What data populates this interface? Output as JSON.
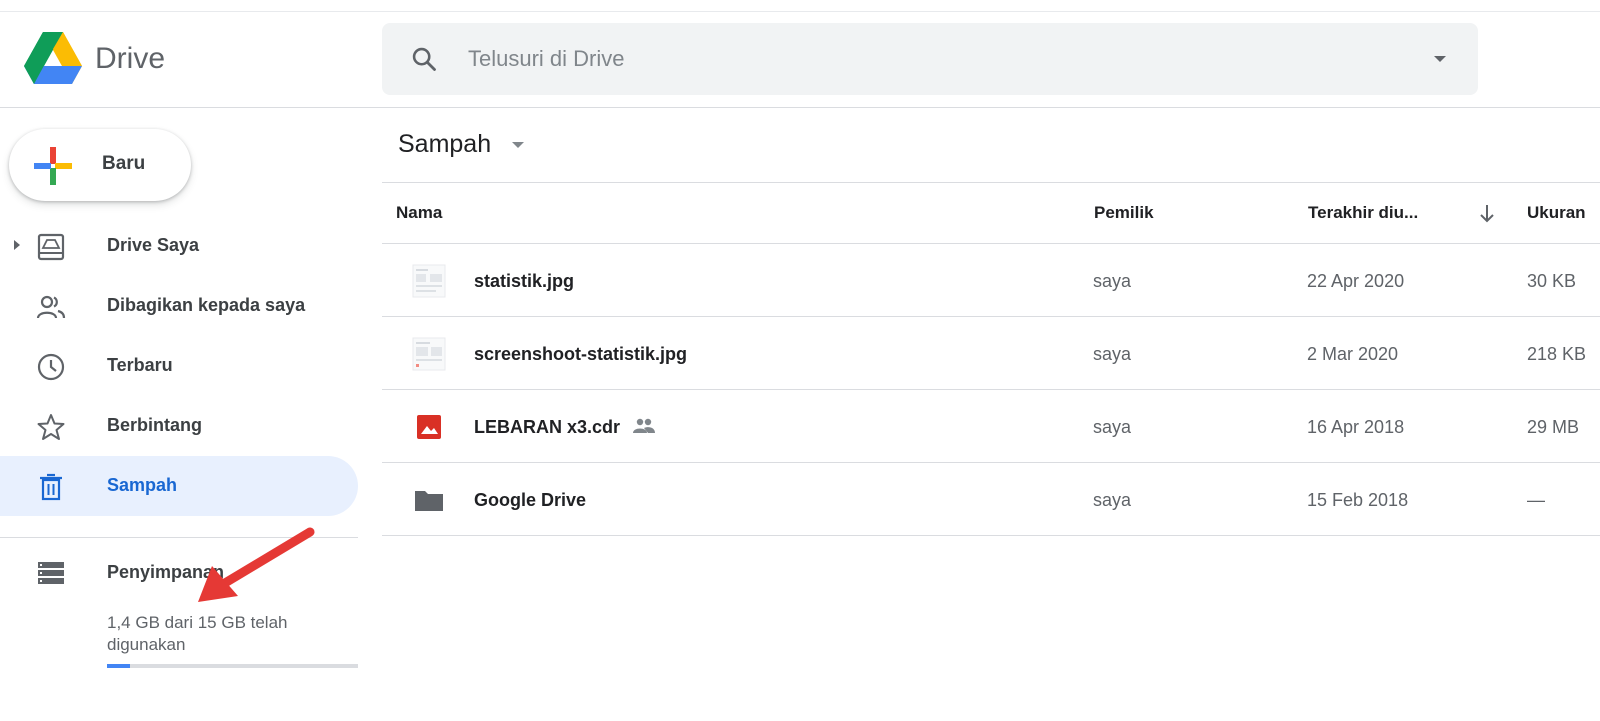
{
  "app": {
    "name": "Drive"
  },
  "search": {
    "placeholder": "Telusuri di Drive"
  },
  "sidebar": {
    "new_label": "Baru",
    "items": [
      {
        "label": "Drive Saya",
        "icon": "my-drive-icon"
      },
      {
        "label": "Dibagikan kepada saya",
        "icon": "shared-people-icon"
      },
      {
        "label": "Terbaru",
        "icon": "clock-icon"
      },
      {
        "label": "Berbintang",
        "icon": "star-icon"
      },
      {
        "label": "Sampah",
        "icon": "trash-icon",
        "active": true
      }
    ],
    "storage": {
      "label": "Penyimpanan",
      "usage_text": "1,4 GB dari 15 GB telah digunakan",
      "used_fraction": 0.093
    }
  },
  "main": {
    "title": "Sampah",
    "columns": {
      "name": "Nama",
      "owner": "Pemilik",
      "modified": "Terakhir diu...",
      "size": "Ukuran"
    },
    "rows": [
      {
        "name": "statistik.jpg",
        "owner": "saya",
        "modified": "22 Apr 2020",
        "size": "30 KB",
        "icon": "image-thumbnail-icon",
        "shared": false
      },
      {
        "name": "screenshoot-statistik.jpg",
        "owner": "saya",
        "modified": "2 Mar 2020",
        "size": "218 KB",
        "icon": "image-thumbnail-icon",
        "shared": false
      },
      {
        "name": "LEBARAN x3.cdr",
        "owner": "saya",
        "modified": "16 Apr 2018",
        "size": "29 MB",
        "icon": "image-file-icon",
        "shared": true
      },
      {
        "name": "Google Drive",
        "owner": "saya",
        "modified": "15 Feb 2018",
        "size": "—",
        "icon": "folder-icon",
        "shared": false
      }
    ]
  },
  "colors": {
    "active_bg": "#e8f0fe",
    "active_text": "#1967d2",
    "arrow_red": "#e53935",
    "storage_fill": "#4285f4"
  }
}
